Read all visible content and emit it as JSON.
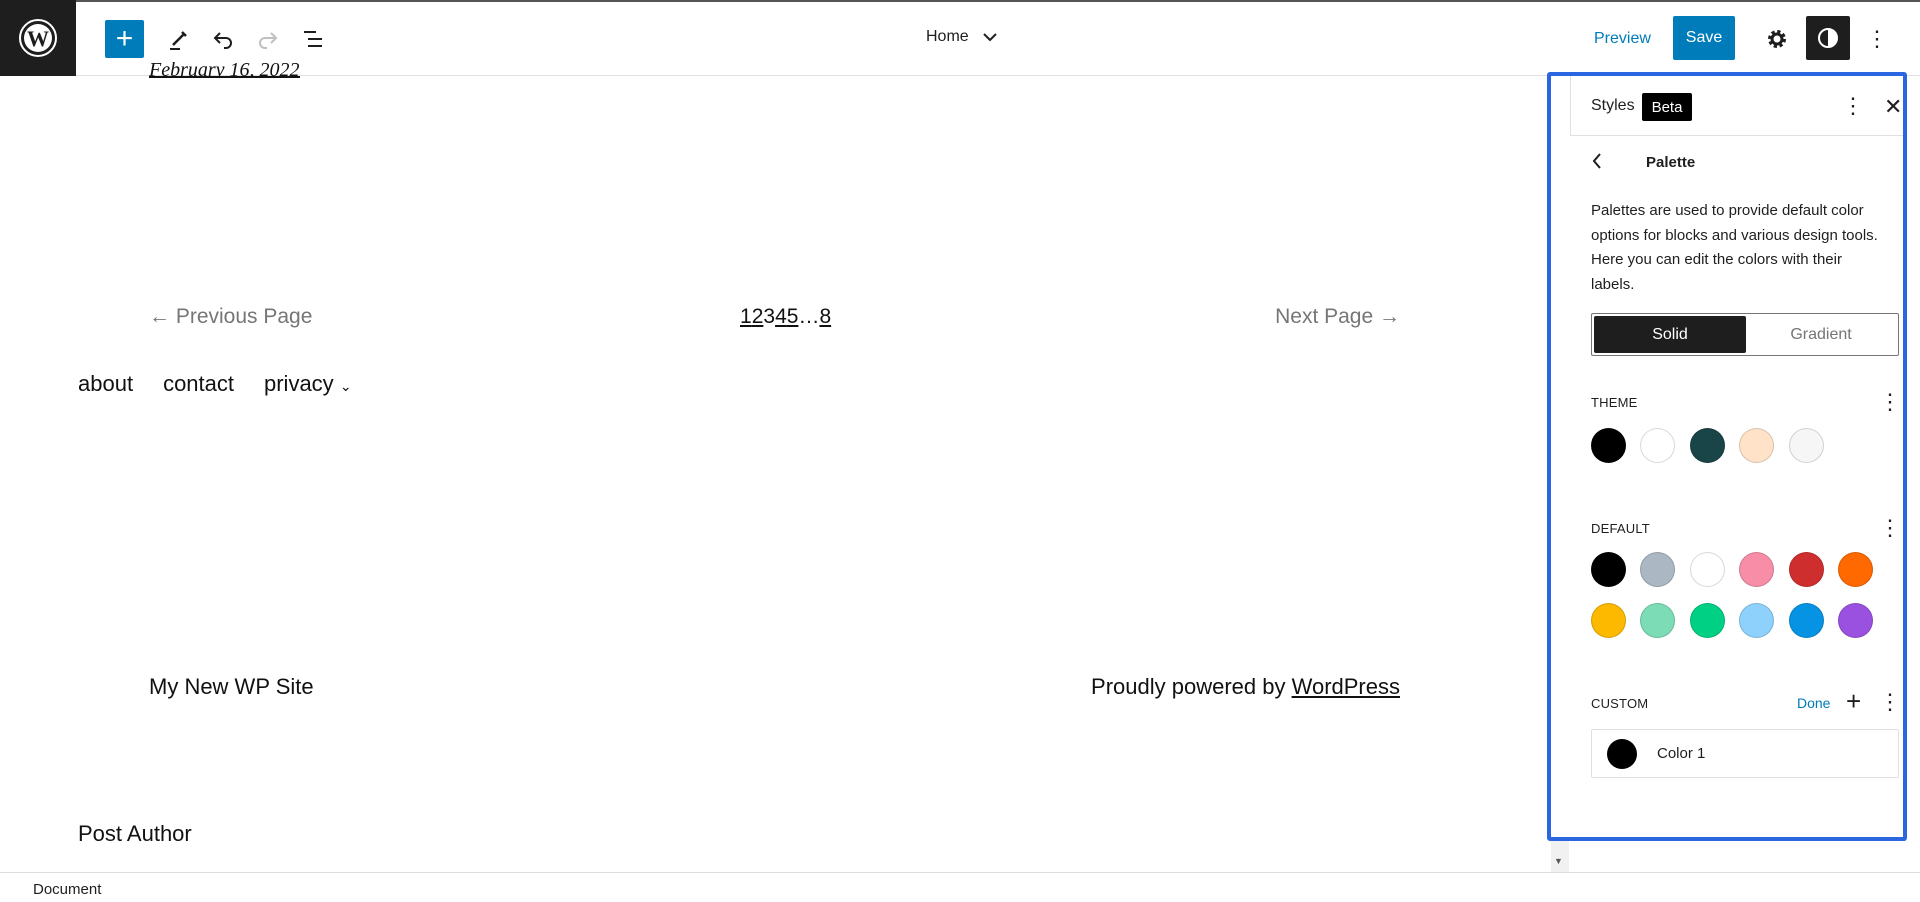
{
  "toolbar": {
    "logo": "wordpress-logo",
    "add_icon": "plus-icon",
    "tools_icon": "pencil-icon",
    "undo_icon": "undo-icon",
    "redo_icon": "redo-icon",
    "list_view_icon": "list-view-icon",
    "template": "Home",
    "preview": "Preview",
    "save": "Save",
    "settings_icon": "gear-icon",
    "styles_icon": "contrast-icon",
    "options_icon": "kebab-icon"
  },
  "content": {
    "date": "February 16, 2022",
    "prev": "← Previous Page",
    "pages": [
      "1",
      "2",
      "3",
      "4",
      "5"
    ],
    "ellipsis": "…",
    "last_page": "8",
    "next": "Next Page →",
    "nav": [
      "about",
      "contact",
      "privacy"
    ],
    "site_title": "My New WP Site",
    "powered_prefix": "Proudly powered by ",
    "powered_link": "WordPress",
    "post_author": "Post Author"
  },
  "sidebar": {
    "title": "Styles",
    "badge": "Beta",
    "panel_title": "Palette",
    "description": "Palettes are used to provide default color options for blocks and various design tools. Here you can edit the colors with their labels.",
    "tabs": [
      "Solid",
      "Gradient"
    ],
    "active_tab": "Solid",
    "theme": {
      "label": "THEME",
      "colors": [
        "#000000",
        "#ffffff",
        "#1a4548",
        "#ffe2c7",
        "#f6f6f6"
      ]
    },
    "default": {
      "label": "DEFAULT",
      "colors": [
        "#000000",
        "#abb8c3",
        "#ffffff",
        "#f78da7",
        "#cf2e2e",
        "#ff6900",
        "#fcb900",
        "#7bdcb5",
        "#00d084",
        "#8ed1fc",
        "#0693e3",
        "#9b51e0"
      ]
    },
    "custom": {
      "label": "CUSTOM",
      "done": "Done",
      "items": [
        {
          "name": "Color 1",
          "color": "#000000"
        }
      ]
    }
  },
  "status": {
    "breadcrumb": "Document"
  },
  "accent": "#007cba",
  "highlight_border": "#2b66e0"
}
